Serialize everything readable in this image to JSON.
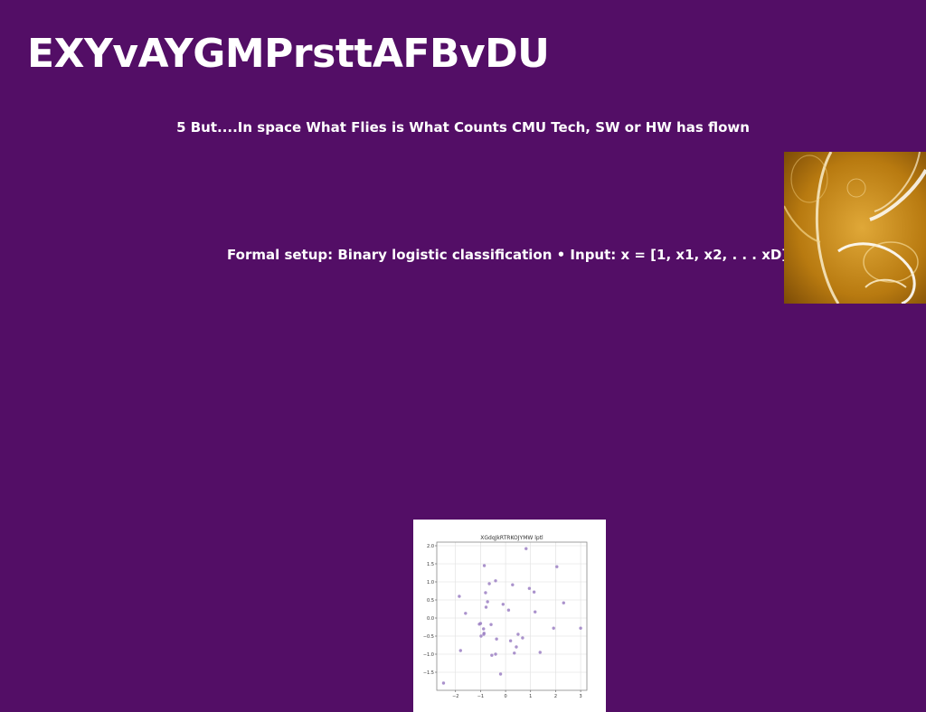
{
  "slide": {
    "background": "#530e66",
    "title": "EXYvAYGMPrsttAFBvDU",
    "line_1": "5 But....In space What Flies is What Counts CMU Tech, SW or HW has flown",
    "line_2": "Formal setup: Binary logistic classification • Input: x = [1, x1, x2, . . . xD]",
    "photo": {
      "icon": "amber-liquid-bubbles-image",
      "colors": [
        "#b87a10",
        "#e0a838",
        "#7a4a06",
        "#ffffff"
      ]
    }
  },
  "chart_data": {
    "type": "scatter",
    "title": "XGdqJkRTRKOJYMW lptl",
    "xlabel": "",
    "ylabel": "",
    "xlim": [
      -2.75,
      3.25
    ],
    "ylim": [
      -2.0,
      2.1
    ],
    "xticks": [
      "−2",
      "−1",
      "0",
      "1",
      "2",
      "3"
    ],
    "yticks": [
      "−1.5",
      "−1.0",
      "−0.5",
      "0.0",
      "0.5",
      "1.0",
      "1.5",
      "2.0"
    ],
    "xtick_values": [
      -2,
      -1,
      0,
      1,
      2,
      3
    ],
    "ytick_values": [
      -1.5,
      -1.0,
      -0.5,
      0.0,
      0.5,
      1.0,
      1.5,
      2.0
    ],
    "grid": true,
    "marker_color": "#9b7fc3",
    "points": [
      [
        -2.48,
        -1.8
      ],
      [
        -1.85,
        0.6
      ],
      [
        -1.8,
        -0.9
      ],
      [
        -1.6,
        0.13
      ],
      [
        -1.05,
        -0.17
      ],
      [
        -1.0,
        -0.15
      ],
      [
        -0.98,
        -0.5
      ],
      [
        -0.88,
        -0.3
      ],
      [
        -0.87,
        -0.45
      ],
      [
        -0.86,
        -0.42
      ],
      [
        -0.85,
        1.45
      ],
      [
        -0.8,
        0.7
      ],
      [
        -0.78,
        0.3
      ],
      [
        -0.72,
        0.45
      ],
      [
        -0.65,
        0.95
      ],
      [
        -0.58,
        -0.18
      ],
      [
        -0.55,
        -1.03
      ],
      [
        -0.4,
        -1.0
      ],
      [
        -0.4,
        1.03
      ],
      [
        -0.36,
        -0.58
      ],
      [
        -0.2,
        -1.55
      ],
      [
        -0.1,
        0.38
      ],
      [
        0.12,
        0.22
      ],
      [
        0.2,
        -0.63
      ],
      [
        0.28,
        0.92
      ],
      [
        0.35,
        -0.97
      ],
      [
        0.43,
        -0.8
      ],
      [
        0.5,
        -0.45
      ],
      [
        0.68,
        -0.55
      ],
      [
        0.82,
        1.92
      ],
      [
        0.95,
        0.82
      ],
      [
        1.14,
        0.72
      ],
      [
        1.18,
        0.17
      ],
      [
        1.38,
        -0.95
      ],
      [
        1.92,
        -0.28
      ],
      [
        2.05,
        1.42
      ],
      [
        2.32,
        0.42
      ],
      [
        3.0,
        -0.28
      ]
    ]
  }
}
